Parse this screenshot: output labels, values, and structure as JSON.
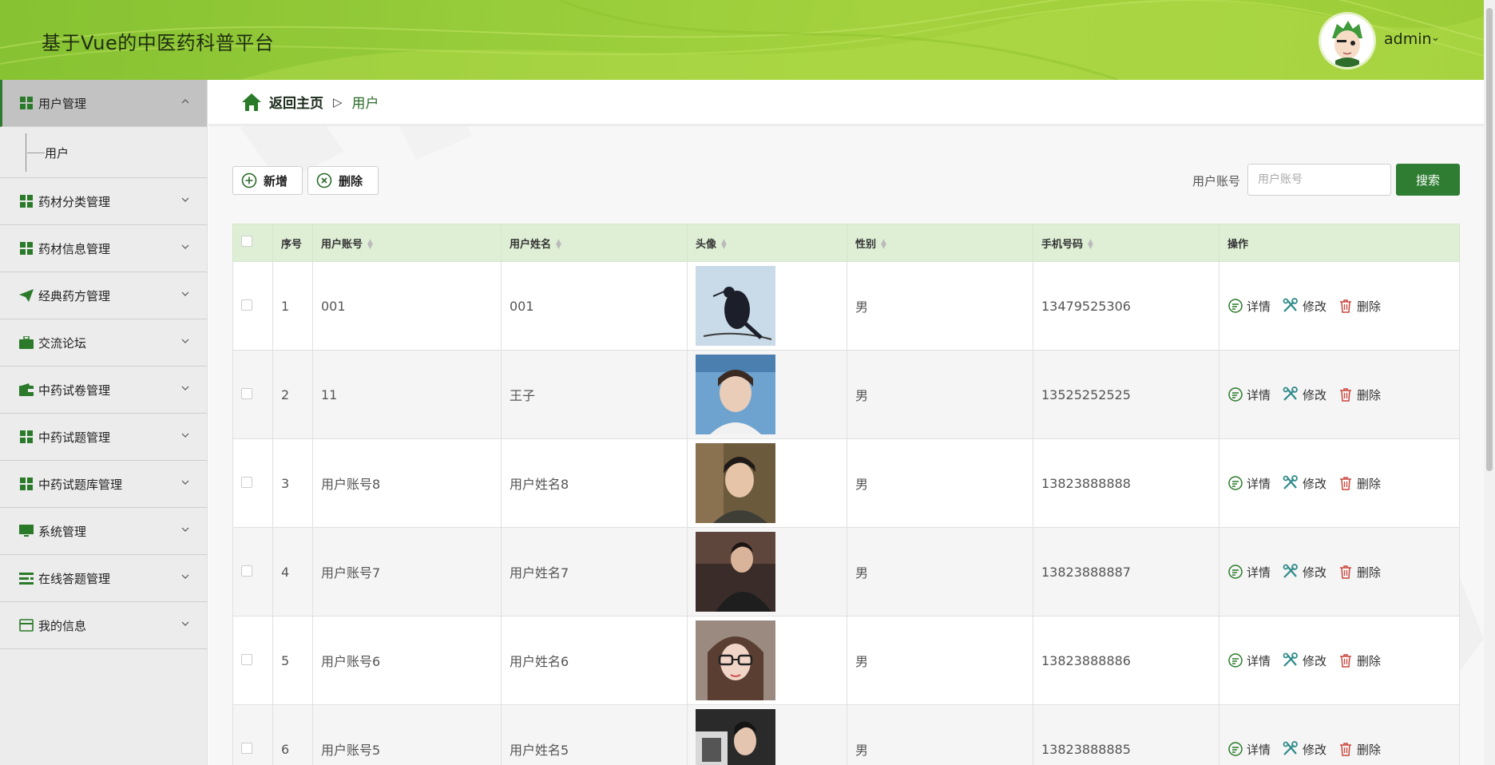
{
  "app": {
    "title": "基于Vue的中医药科普平台"
  },
  "user": {
    "name": "admin"
  },
  "sidebar": {
    "items": [
      {
        "label": "用户管理",
        "icon": "grid-icon",
        "expanded": true,
        "children": [
          {
            "label": "用户"
          }
        ]
      },
      {
        "label": "药材分类管理",
        "icon": "grid-icon"
      },
      {
        "label": "药材信息管理",
        "icon": "grid-icon"
      },
      {
        "label": "经典药方管理",
        "icon": "paper-plane-icon"
      },
      {
        "label": "交流论坛",
        "icon": "briefcase-icon"
      },
      {
        "label": "中药试卷管理",
        "icon": "wallet-icon"
      },
      {
        "label": "中药试题管理",
        "icon": "grid-icon"
      },
      {
        "label": "中药试题库管理",
        "icon": "grid-icon"
      },
      {
        "label": "系统管理",
        "icon": "monitor-icon"
      },
      {
        "label": "在线答题管理",
        "icon": "list-icon"
      },
      {
        "label": "我的信息",
        "icon": "card-icon"
      }
    ]
  },
  "breadcrumb": {
    "home": "返回主页",
    "separator": "▷",
    "current": "用户"
  },
  "toolbar": {
    "add_label": "新增",
    "delete_label": "删除"
  },
  "search": {
    "label": "用户账号",
    "placeholder": "用户账号",
    "value": "",
    "button_label": "搜索"
  },
  "table": {
    "headers": {
      "index": "序号",
      "account": "用户账号",
      "name": "用户姓名",
      "avatar": "头像",
      "gender": "性别",
      "phone": "手机号码",
      "actions": "操作"
    },
    "rows": [
      {
        "index": "1",
        "account": "001",
        "name": "001",
        "gender": "男",
        "phone": "13479525306"
      },
      {
        "index": "2",
        "account": "11",
        "name": "王子",
        "gender": "男",
        "phone": "13525252525"
      },
      {
        "index": "3",
        "account": "用户账号8",
        "name": "用户姓名8",
        "gender": "男",
        "phone": "13823888888"
      },
      {
        "index": "4",
        "account": "用户账号7",
        "name": "用户姓名7",
        "gender": "男",
        "phone": "13823888887"
      },
      {
        "index": "5",
        "account": "用户账号6",
        "name": "用户姓名6",
        "gender": "男",
        "phone": "13823888886"
      },
      {
        "index": "6",
        "account": "用户账号5",
        "name": "用户姓名5",
        "gender": "男",
        "phone": "13823888885"
      }
    ],
    "row_actions": {
      "detail": "详情",
      "edit": "修改",
      "delete": "删除"
    }
  },
  "colors": {
    "header_green": "#9ccd38",
    "accent": "#2f7d32",
    "table_header_bg": "#dfefd6"
  }
}
